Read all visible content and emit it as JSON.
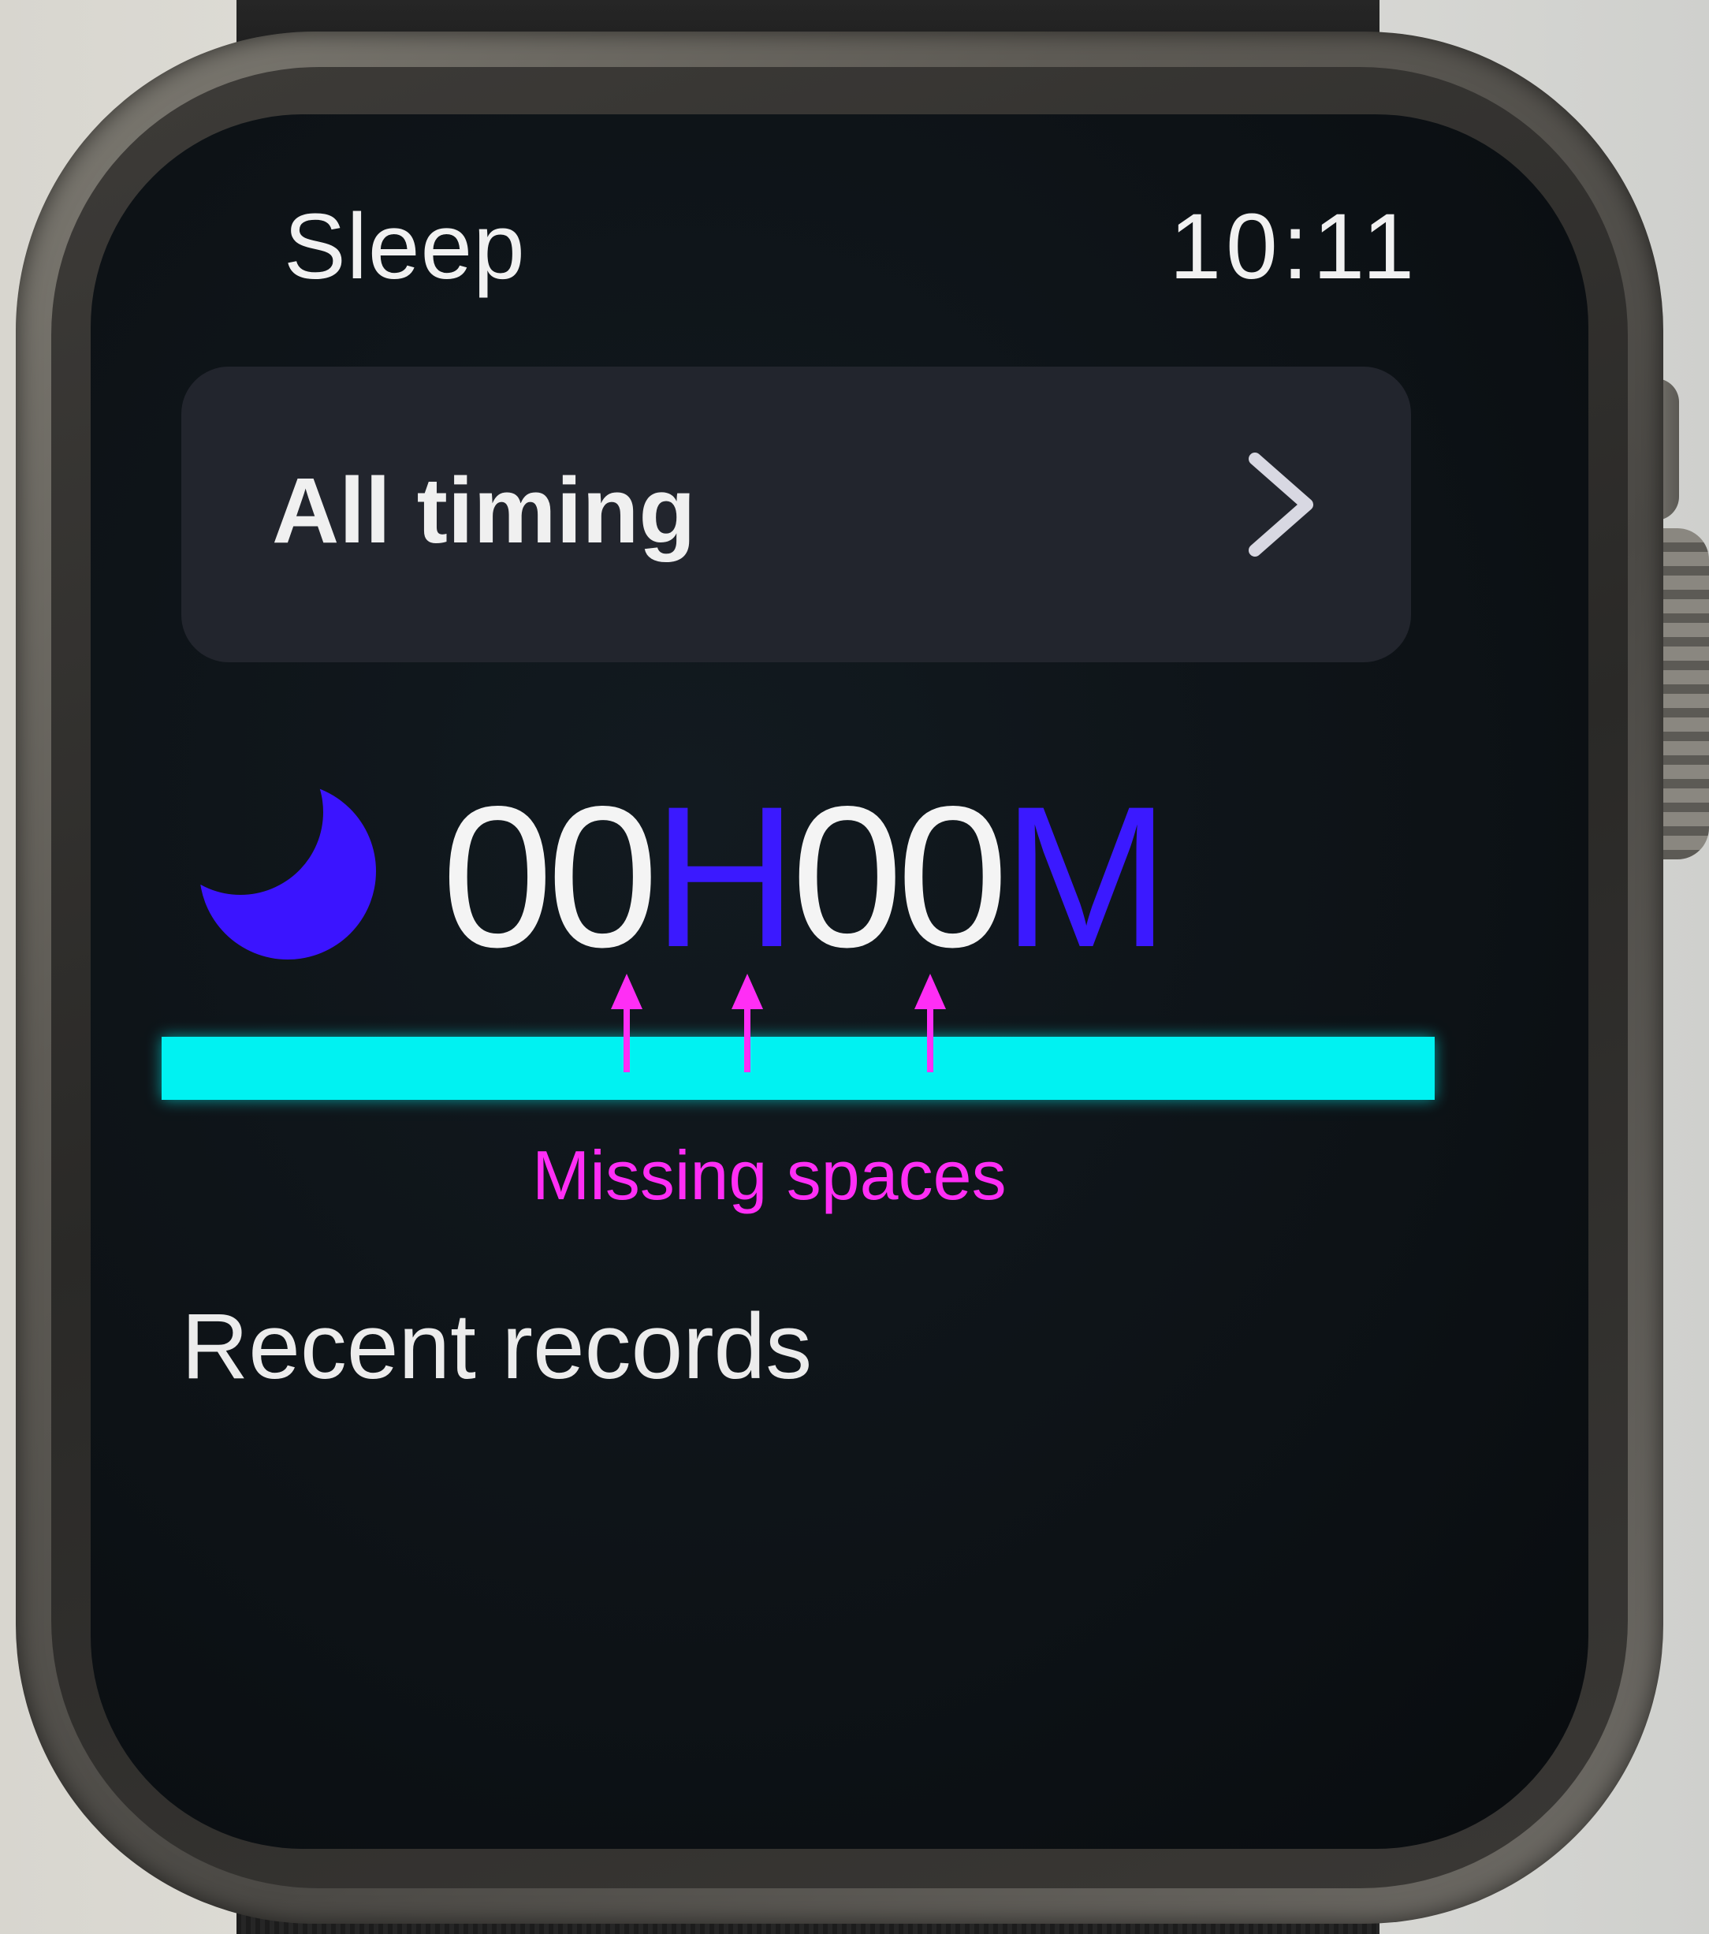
{
  "app": {
    "title": "Sleep",
    "time": "10:11"
  },
  "timing_card": {
    "label": "All timing",
    "chevron_icon": "chevron-right-icon"
  },
  "sleep_summary": {
    "moon_icon": "moon-icon",
    "hours": "00",
    "hour_unit": "H",
    "minutes": "00",
    "minute_unit": "M",
    "unit_color": "#3b19ff",
    "progress_fraction": 1.0,
    "progress_color": "#00f2f2"
  },
  "recent": {
    "title": "Recent records"
  },
  "annotation": {
    "text": "Missing spaces",
    "color": "#ff2ef5",
    "arrow_count": 3
  }
}
